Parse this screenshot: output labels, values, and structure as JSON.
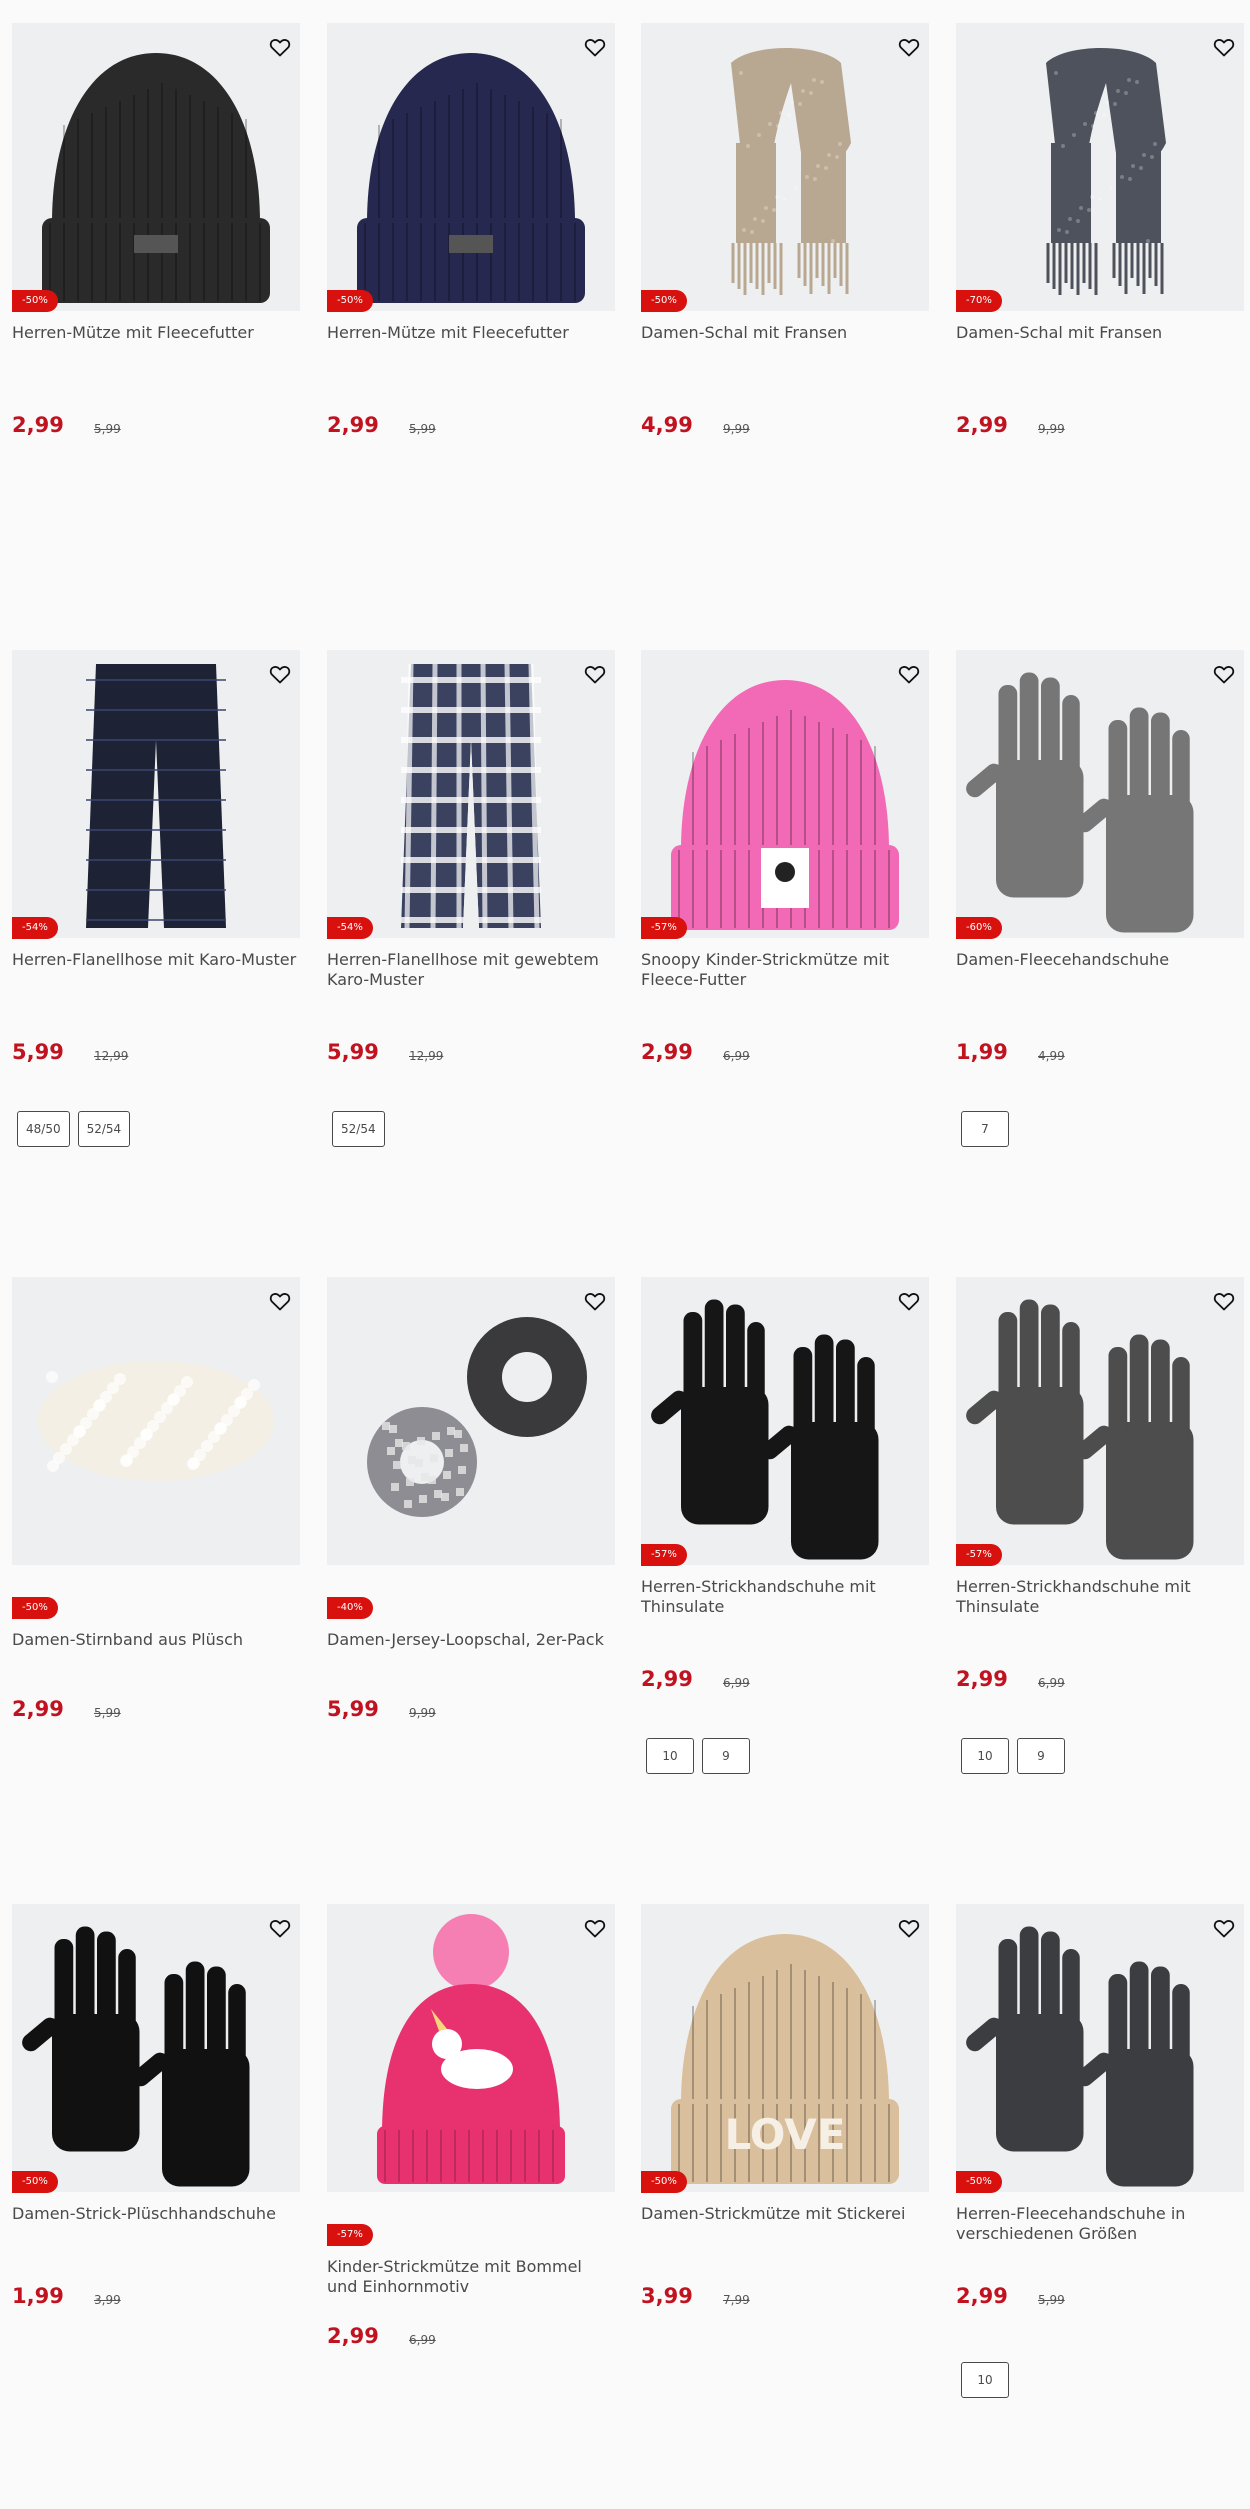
{
  "products": [
    {
      "title": "Herren-Mütze mit Fleecefutter",
      "discount": "-50%",
      "price": "2,99",
      "old_price": "5,99",
      "sizes": [],
      "image": "black-beanie",
      "color": "#2a2a2a"
    },
    {
      "title": "Herren-Mütze mit Fleecefutter",
      "discount": "-50%",
      "price": "2,99",
      "old_price": "5,99",
      "sizes": [],
      "image": "navy-beanie",
      "color": "#27284f"
    },
    {
      "title": "Damen-Schal mit Fransen",
      "discount": "-50%",
      "price": "4,99",
      "old_price": "9,99",
      "sizes": [],
      "image": "beige-scarf",
      "color": "#b9a891"
    },
    {
      "title": "Damen-Schal mit Fransen",
      "discount": "-70%",
      "price": "2,99",
      "old_price": "9,99",
      "sizes": [],
      "image": "grey-scarf",
      "color": "#4d525c"
    },
    {
      "title": "Herren-Flanellhose mit Karo-Muster",
      "discount": "-54%",
      "price": "5,99",
      "old_price": "12,99",
      "sizes": [
        "48/50",
        "52/54"
      ],
      "image": "dark-plaid-pants",
      "color": "#1e2235"
    },
    {
      "title": "Herren-Flanellhose mit gewebtem Karo-Muster",
      "discount": "-54%",
      "price": "5,99",
      "old_price": "12,99",
      "sizes": [
        "52/54"
      ],
      "image": "plaid-pants",
      "color": "#3a4260"
    },
    {
      "title": "Snoopy Kinder-Strickmütze mit Fleece-Futter",
      "discount": "-57%",
      "price": "2,99",
      "old_price": "6,99",
      "sizes": [],
      "image": "pink-beanie",
      "color": "#f26ab5"
    },
    {
      "title": "Damen-Fleecehandschuhe",
      "discount": "-60%",
      "price": "1,99",
      "old_price": "4,99",
      "sizes": [
        "7"
      ],
      "image": "grey-fleece-gloves",
      "color": "#767676"
    },
    {
      "title": "Damen-Stirnband aus Plüsch",
      "discount": "-50%",
      "price": "2,99",
      "old_price": "5,99",
      "sizes": [],
      "image": "plush-headband",
      "color": "#f3ede3"
    },
    {
      "title": "Damen-Jersey-Loopschal, 2er-Pack",
      "discount": "-40%",
      "price": "5,99",
      "old_price": "9,99",
      "sizes": [],
      "image": "loop-scarves",
      "color": "#3a3a3c"
    },
    {
      "title": "Herren-Strickhandschuhe mit Thinsulate",
      "discount": "-57%",
      "price": "2,99",
      "old_price": "6,99",
      "sizes": [
        "10",
        "9"
      ],
      "image": "black-knit-gloves",
      "color": "#161616"
    },
    {
      "title": "Herren-Strickhandschuhe mit Thinsulate",
      "discount": "-57%",
      "price": "2,99",
      "old_price": "6,99",
      "sizes": [
        "10",
        "9"
      ],
      "image": "grey-knit-gloves",
      "color": "#4d4d4d"
    },
    {
      "title": "Damen-Strick-Plüschhandschuhe",
      "discount": "-50%",
      "price": "1,99",
      "old_price": "3,99",
      "sizes": [],
      "image": "black-plush-gloves",
      "color": "#111111"
    },
    {
      "title": "Kinder-Strickmütze mit Bommel und Einhornmotiv",
      "discount": "-57%",
      "price": "2,99",
      "old_price": "6,99",
      "sizes": [],
      "image": "unicorn-pompom-hat",
      "color": "#e8326f"
    },
    {
      "title": "Damen-Strickmütze mit Stickerei",
      "discount": "-50%",
      "price": "3,99",
      "old_price": "7,99",
      "sizes": [],
      "image": "love-beanie",
      "color": "#d9bf9c"
    },
    {
      "title": "Herren-Fleecehandschuhe in verschiedenen Größen",
      "discount": "-50%",
      "price": "2,99",
      "old_price": "5,99",
      "sizes": [
        "10"
      ],
      "image": "dark-fleece-gloves",
      "color": "#3c3d40"
    }
  ]
}
